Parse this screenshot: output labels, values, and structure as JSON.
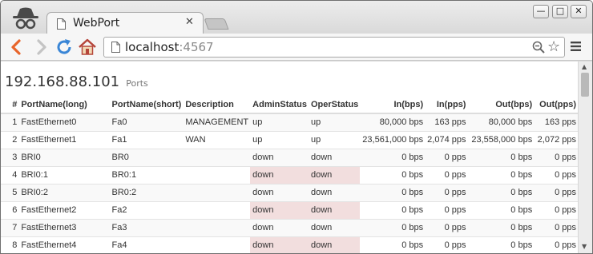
{
  "browser": {
    "tab_title": "WebPort",
    "tab_close": "✕",
    "url_host": "localhost",
    "url_port": ":4567",
    "window_min": "—",
    "window_max": "□",
    "window_close": "✕",
    "star": "☆"
  },
  "page": {
    "ip": "192.168.88.101",
    "subtitle": "Ports"
  },
  "table": {
    "headers": {
      "num": "#",
      "name_long": "PortName(long)",
      "name_short": "PortName(short)",
      "description": "Description",
      "admin": "AdminStatus",
      "oper": "OperStatus",
      "in_bps": "In(bps)",
      "in_pps": "In(pps)",
      "out_bps": "Out(bps)",
      "out_pps": "Out(pps)"
    },
    "rows": [
      {
        "num": "1",
        "name_long": "FastEthernet0",
        "name_short": "Fa0",
        "description": "MANAGEMENT",
        "admin": "up",
        "oper": "up",
        "in_bps": "80,000 bps",
        "in_pps": "163 pps",
        "out_bps": "80,000 bps",
        "out_pps": "163 pps"
      },
      {
        "num": "2",
        "name_long": "FastEthernet1",
        "name_short": "Fa1",
        "description": "WAN",
        "admin": "up",
        "oper": "up",
        "in_bps": "23,561,000 bps",
        "in_pps": "2,074 pps",
        "out_bps": "23,558,000 bps",
        "out_pps": "2,072 pps"
      },
      {
        "num": "3",
        "name_long": "BRI0",
        "name_short": "BR0",
        "description": "",
        "admin": "down",
        "oper": "down",
        "in_bps": "0 bps",
        "in_pps": "0 pps",
        "out_bps": "0 bps",
        "out_pps": "0 pps"
      },
      {
        "num": "4",
        "name_long": "BRI0:1",
        "name_short": "BR0:1",
        "description": "",
        "admin": "down",
        "oper": "down",
        "in_bps": "0 bps",
        "in_pps": "0 pps",
        "out_bps": "0 bps",
        "out_pps": "0 pps"
      },
      {
        "num": "5",
        "name_long": "BRI0:2",
        "name_short": "BR0:2",
        "description": "",
        "admin": "down",
        "oper": "down",
        "in_bps": "0 bps",
        "in_pps": "0 pps",
        "out_bps": "0 bps",
        "out_pps": "0 pps"
      },
      {
        "num": "6",
        "name_long": "FastEthernet2",
        "name_short": "Fa2",
        "description": "",
        "admin": "down",
        "oper": "down",
        "in_bps": "0 bps",
        "in_pps": "0 pps",
        "out_bps": "0 bps",
        "out_pps": "0 pps"
      },
      {
        "num": "7",
        "name_long": "FastEthernet3",
        "name_short": "Fa3",
        "description": "",
        "admin": "down",
        "oper": "down",
        "in_bps": "0 bps",
        "in_pps": "0 pps",
        "out_bps": "0 bps",
        "out_pps": "0 pps"
      },
      {
        "num": "8",
        "name_long": "FastEthernet4",
        "name_short": "Fa4",
        "description": "",
        "admin": "down",
        "oper": "down",
        "in_bps": "0 bps",
        "in_pps": "0 pps",
        "out_bps": "0 bps",
        "out_pps": "0 pps"
      }
    ]
  },
  "colors": {
    "status_down_bg": "#f2dede",
    "back_arrow": "#e8652b",
    "reload": "#3a86d6"
  },
  "icons": {
    "incognito": "incognito-icon",
    "page": "page-icon",
    "back": "back-arrow-icon",
    "forward": "forward-arrow-icon",
    "reload": "reload-icon",
    "home": "home-icon",
    "zoom": "zoom-icon",
    "bookmark": "star-icon",
    "menu": "menu-icon"
  }
}
